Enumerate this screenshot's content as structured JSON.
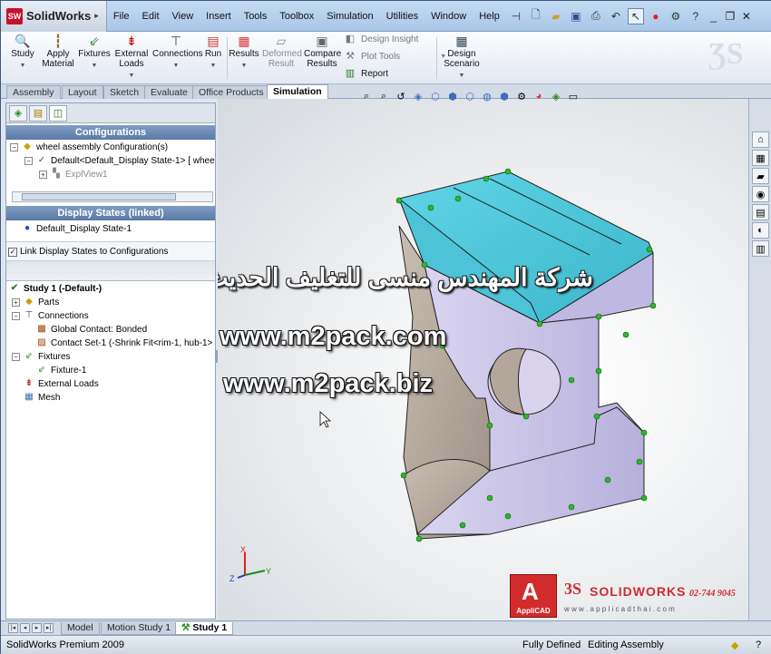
{
  "app": {
    "logo_text": "SolidWorks",
    "logo_badge": "SW"
  },
  "menu": [
    "File",
    "Edit",
    "View",
    "Insert",
    "Tools",
    "Toolbox",
    "Simulation",
    "Utilities",
    "Window",
    "Help"
  ],
  "commands": {
    "study": "Study",
    "apply_material": [
      "Apply",
      "Material"
    ],
    "fixtures": "Fixtures",
    "external_loads": [
      "External",
      "Loads"
    ],
    "connections": "Connections",
    "run": "Run",
    "results": "Results",
    "deformed_result": [
      "Deformed",
      "Result"
    ],
    "compare_results": [
      "Compare",
      "Results"
    ],
    "design_insight": "Design Insight",
    "plot_tools": "Plot Tools",
    "report": "Report",
    "design_scenario": [
      "Design",
      "Scenario"
    ]
  },
  "tabs": [
    "Assembly",
    "Layout",
    "Sketch",
    "Evaluate",
    "Office Products",
    "Simulation"
  ],
  "panel": {
    "configurations_header": "Configurations",
    "config_tree": [
      "wheel assembly Configuration(s)",
      "Default<Default_Display State-1> [ whee",
      "ExplView1"
    ],
    "display_states_header": "Display States (linked)",
    "display_state": "Default_Display State-1",
    "link_checkbox_label": "Link Display States to Configurations",
    "study_tree": [
      "Study 1 (-Default-)",
      "Parts",
      "Connections",
      "Global Contact: Bonded",
      "Contact Set-1 (-Shrink Fit<rim-1, hub-1>",
      "Fixtures",
      "Fixture-1",
      "External Loads",
      "Mesh"
    ]
  },
  "watermark": {
    "arabic": "شركة المهندس منسى للتغليف الحديث",
    "url1": "www.m2pack.com",
    "url2": "www.m2pack.biz"
  },
  "branding": {
    "applicad": "AppliCAD",
    "ds_text": "SOLIDWORKS",
    "ds_prefix": "3S",
    "phone": "02-744 9045",
    "website": "w w w . a p p l i c a d t h a i . c o m"
  },
  "triad": {
    "x": "X",
    "y": "Y",
    "z": "Z"
  },
  "bottom_tabs": [
    "Model",
    "Motion Study 1",
    "Study 1"
  ],
  "status": {
    "product": "SolidWorks Premium 2009",
    "state": "Fully Defined",
    "mode": "Editing Assembly"
  },
  "colors": {
    "top_face": "#5fd6e6",
    "side_face": "#c9c3e6",
    "body_face": "#b7aca0",
    "constraint": "#2fb52f"
  }
}
